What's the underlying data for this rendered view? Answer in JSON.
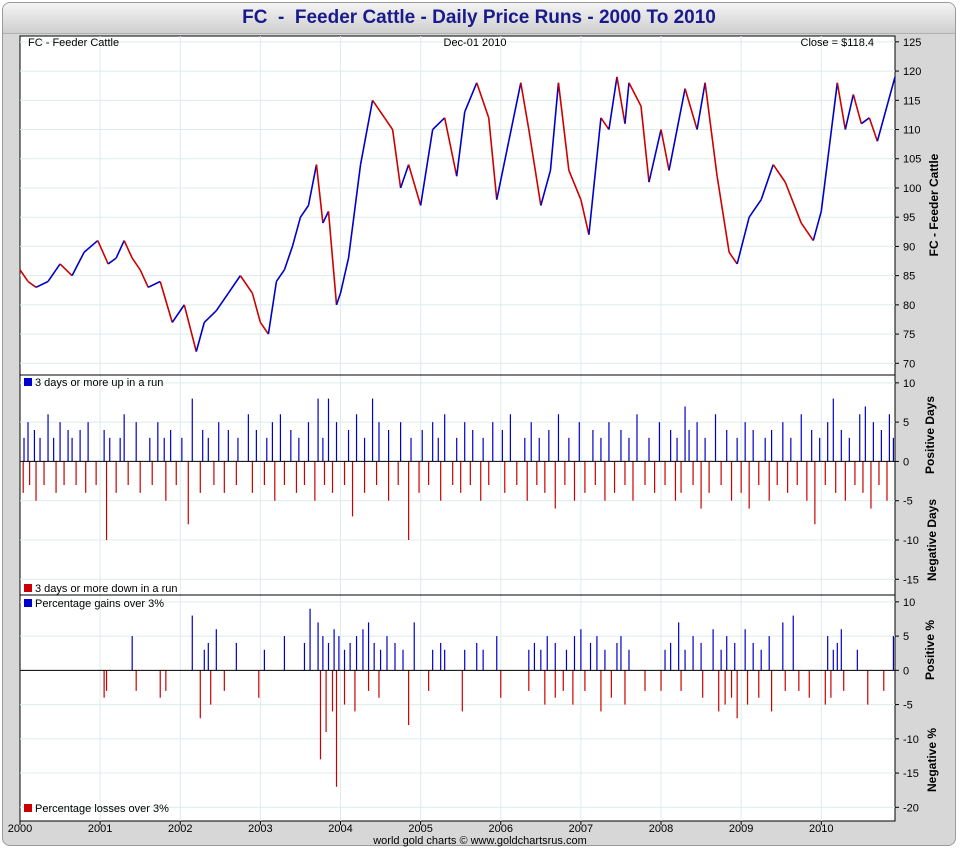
{
  "page": {
    "title": "FC  -  Feeder Cattle - Daily Price Runs - 2000 To 2010",
    "footer": "world gold charts © www.goldchartsrus.com"
  },
  "colors": {
    "up": "#0000cc",
    "down": "#cc0000",
    "price": "#000000",
    "grid": "#dcecec"
  },
  "chart_data": [
    {
      "type": "line",
      "panel": "price",
      "header_left": "FC  -  Feeder Cattle",
      "header_center": "Dec-01  2010",
      "header_right": "Close = $118.4",
      "ylabel": "FC  -  Feeder Cattle",
      "ylim": [
        68,
        126
      ],
      "yticks": [
        70,
        75,
        80,
        85,
        90,
        95,
        100,
        105,
        110,
        115,
        120,
        125
      ],
      "xlim": [
        2000.0,
        2010.92
      ],
      "series": [
        {
          "x": [
            2000.0,
            2000.1,
            2000.2,
            2000.35,
            2000.5,
            2000.65,
            2000.8,
            2000.97,
            2001.1,
            2001.2,
            2001.3,
            2001.4,
            2001.5,
            2001.6,
            2001.75,
            2001.9,
            2002.05,
            2002.2,
            2002.3,
            2002.45,
            2002.6,
            2002.75,
            2002.9,
            2003.0,
            2003.1,
            2003.2,
            2003.3,
            2003.4,
            2003.5,
            2003.6,
            2003.7,
            2003.78,
            2003.85,
            2003.95,
            2004.0,
            2004.1,
            2004.25,
            2004.4,
            2004.55,
            2004.65,
            2004.75,
            2004.85,
            2005.0,
            2005.15,
            2005.3,
            2005.45,
            2005.55,
            2005.7,
            2005.85,
            2005.95,
            2006.1,
            2006.25,
            2006.35,
            2006.5,
            2006.62,
            2006.72,
            2006.85,
            2007.0,
            2007.1,
            2007.25,
            2007.35,
            2007.45,
            2007.55,
            2007.6,
            2007.75,
            2007.85,
            2008.0,
            2008.1,
            2008.3,
            2008.45,
            2008.55,
            2008.7,
            2008.85,
            2008.95,
            2009.1,
            2009.25,
            2009.4,
            2009.55,
            2009.75,
            2009.9,
            2010.0,
            2010.1,
            2010.2,
            2010.3,
            2010.4,
            2010.5,
            2010.6,
            2010.7,
            2010.8,
            2010.92
          ],
          "y": [
            86,
            84,
            83,
            84,
            87,
            85,
            89,
            91,
            87,
            88,
            91,
            88,
            86,
            83,
            84,
            77,
            80,
            72,
            77,
            79,
            82,
            85,
            82,
            77,
            75,
            84,
            86,
            90,
            95,
            97,
            104,
            94,
            96,
            80,
            82,
            88,
            104,
            115,
            112,
            110,
            100,
            104,
            97,
            110,
            112,
            102,
            113,
            118,
            112,
            98,
            108,
            118,
            110,
            97,
            103,
            118,
            103,
            98,
            92,
            112,
            110,
            119,
            111,
            118,
            114,
            101,
            110,
            103,
            117,
            110,
            118,
            102,
            89,
            87,
            95,
            98,
            104,
            101,
            94,
            91,
            96,
            107,
            118,
            110,
            116,
            111,
            112,
            108,
            113,
            119
          ]
        }
      ]
    },
    {
      "type": "bar",
      "panel": "days",
      "legend_top": "3 days or more up in a run",
      "legend_bottom": "3 days or more down in a run",
      "ylabel_top": "Positive Days",
      "ylabel_bottom": "Negative Days",
      "ylim": [
        -17,
        11
      ],
      "yticks": [
        10,
        5,
        0,
        -5,
        -10,
        -15
      ],
      "series": [
        {
          "name": "3 days or more up in a run",
          "x": [
            2000.05,
            2000.1,
            2000.18,
            2000.25,
            2000.35,
            2000.42,
            2000.5,
            2000.6,
            2000.65,
            2000.75,
            2000.85,
            2001.05,
            2001.12,
            2001.25,
            2001.3,
            2001.45,
            2001.62,
            2001.72,
            2001.8,
            2001.88,
            2002.02,
            2002.15,
            2002.28,
            2002.35,
            2002.48,
            2002.6,
            2002.72,
            2002.85,
            2002.95,
            2003.08,
            2003.15,
            2003.25,
            2003.38,
            2003.48,
            2003.6,
            2003.72,
            2003.78,
            2003.85,
            2003.95,
            2004.1,
            2004.2,
            2004.3,
            2004.4,
            2004.48,
            2004.6,
            2004.75,
            2004.88,
            2005.02,
            2005.15,
            2005.22,
            2005.3,
            2005.45,
            2005.55,
            2005.65,
            2005.78,
            2005.9,
            2006.02,
            2006.12,
            2006.3,
            2006.38,
            2006.48,
            2006.6,
            2006.72,
            2006.85,
            2006.98,
            2007.15,
            2007.25,
            2007.35,
            2007.5,
            2007.6,
            2007.7,
            2007.85,
            2007.98,
            2008.12,
            2008.2,
            2008.3,
            2008.35,
            2008.45,
            2008.55,
            2008.68,
            2008.82,
            2008.95,
            2009.05,
            2009.15,
            2009.3,
            2009.38,
            2009.52,
            2009.62,
            2009.75,
            2009.88,
            2009.98,
            2010.08,
            2010.15,
            2010.25,
            2010.35,
            2010.48,
            2010.55,
            2010.65,
            2010.75,
            2010.85,
            2010.9
          ],
          "values": [
            3,
            5,
            4,
            3,
            6,
            3,
            5,
            4,
            3,
            4,
            5,
            4,
            3,
            3,
            6,
            5,
            3,
            5,
            3,
            4,
            3,
            8,
            4,
            3,
            5,
            4,
            3,
            6,
            4,
            3,
            5,
            6,
            4,
            3,
            5,
            8,
            3,
            8,
            5,
            4,
            6,
            3,
            8,
            5,
            4,
            5,
            3,
            4,
            5,
            3,
            6,
            3,
            5,
            4,
            3,
            5,
            4,
            6,
            3,
            5,
            3,
            4,
            6,
            3,
            5,
            4,
            3,
            5,
            4,
            3,
            6,
            3,
            5,
            4,
            3,
            7,
            4,
            5,
            3,
            6,
            4,
            3,
            5,
            4,
            3,
            4,
            5,
            3,
            6,
            4,
            3,
            5,
            8,
            4,
            3,
            6,
            7,
            5,
            4,
            6,
            3
          ]
        },
        {
          "name": "3 days or more down in a run",
          "x": [
            2000.04,
            2000.12,
            2000.2,
            2000.3,
            2000.45,
            2000.55,
            2000.7,
            2000.82,
            2000.95,
            2001.08,
            2001.2,
            2001.35,
            2001.5,
            2001.65,
            2001.82,
            2001.95,
            2002.1,
            2002.25,
            2002.42,
            2002.55,
            2002.7,
            2002.9,
            2003.05,
            2003.18,
            2003.3,
            2003.45,
            2003.55,
            2003.68,
            2003.8,
            2003.9,
            2004.05,
            2004.15,
            2004.3,
            2004.45,
            2004.6,
            2004.72,
            2004.85,
            2004.98,
            2005.1,
            2005.25,
            2005.4,
            2005.5,
            2005.62,
            2005.75,
            2005.85,
            2006.05,
            2006.2,
            2006.33,
            2006.45,
            2006.55,
            2006.68,
            2006.8,
            2006.92,
            2007.05,
            2007.18,
            2007.3,
            2007.42,
            2007.55,
            2007.65,
            2007.8,
            2007.92,
            2008.05,
            2008.18,
            2008.25,
            2008.4,
            2008.5,
            2008.6,
            2008.75,
            2008.88,
            2009.0,
            2009.1,
            2009.22,
            2009.35,
            2009.45,
            2009.58,
            2009.7,
            2009.82,
            2009.92,
            2010.05,
            2010.18,
            2010.3,
            2010.42,
            2010.52,
            2010.62,
            2010.72,
            2010.82
          ],
          "values": [
            -4,
            -3,
            -5,
            -3,
            -4,
            -3,
            -3,
            -4,
            -3,
            -10,
            -4,
            -3,
            -4,
            -3,
            -5,
            -3,
            -8,
            -4,
            -3,
            -4,
            -3,
            -4,
            -3,
            -5,
            -3,
            -4,
            -3,
            -5,
            -3,
            -4,
            -3,
            -7,
            -4,
            -3,
            -5,
            -3,
            -10,
            -4,
            -3,
            -5,
            -3,
            -4,
            -3,
            -5,
            -3,
            -4,
            -3,
            -5,
            -3,
            -4,
            -6,
            -3,
            -5,
            -4,
            -3,
            -5,
            -4,
            -3,
            -5,
            -3,
            -4,
            -3,
            -5,
            -4,
            -3,
            -6,
            -4,
            -3,
            -5,
            -4,
            -6,
            -3,
            -5,
            -3,
            -4,
            -3,
            -5,
            -8,
            -3,
            -4,
            -5,
            -3,
            -4,
            -6,
            -3,
            -5
          ]
        }
      ]
    },
    {
      "type": "bar",
      "panel": "percent",
      "legend_top": "Percentage gains over 3%",
      "legend_bottom": "Percentage losses over 3%",
      "ylabel_top": "Positive %",
      "ylabel_bottom": "Negative %",
      "ylim": [
        -22,
        11
      ],
      "yticks": [
        10,
        5,
        0,
        -5,
        -10,
        -15,
        -20
      ],
      "series": [
        {
          "name": "Percentage gains over 3%",
          "x": [
            2001.4,
            2002.15,
            2002.3,
            2002.35,
            2002.45,
            2002.7,
            2003.05,
            2003.3,
            2003.55,
            2003.62,
            2003.72,
            2003.78,
            2003.85,
            2003.92,
            2003.98,
            2004.05,
            2004.12,
            2004.2,
            2004.28,
            2004.35,
            2004.42,
            2004.5,
            2004.58,
            2004.68,
            2004.78,
            2004.92,
            2005.15,
            2005.25,
            2005.3,
            2005.55,
            2005.7,
            2005.78,
            2005.95,
            2006.35,
            2006.42,
            2006.5,
            2006.58,
            2006.68,
            2006.82,
            2006.92,
            2007.0,
            2007.12,
            2007.2,
            2007.3,
            2007.45,
            2007.5,
            2007.6,
            2008.05,
            2008.12,
            2008.22,
            2008.3,
            2008.4,
            2008.5,
            2008.65,
            2008.75,
            2008.82,
            2008.92,
            2009.05,
            2009.15,
            2009.25,
            2009.35,
            2009.52,
            2009.65,
            2010.08,
            2010.15,
            2010.2,
            2010.25,
            2010.45,
            2010.9
          ],
          "values": [
            5,
            8,
            3,
            4,
            6,
            4,
            3,
            5,
            4,
            9,
            7,
            5,
            4,
            6,
            5,
            3,
            4,
            5,
            6,
            7,
            4,
            3,
            5,
            4,
            3,
            7,
            3,
            4,
            3,
            3,
            4,
            3,
            5,
            3,
            4,
            3,
            5,
            4,
            3,
            5,
            6,
            4,
            5,
            3,
            4,
            5,
            3,
            3,
            4,
            7,
            3,
            5,
            4,
            6,
            3,
            5,
            4,
            6,
            4,
            3,
            5,
            7,
            8,
            5,
            3,
            4,
            6,
            3,
            5
          ]
        },
        {
          "name": "Percentage losses over 3%",
          "x": [
            2001.05,
            2001.08,
            2001.45,
            2001.75,
            2001.82,
            2002.25,
            2002.38,
            2002.55,
            2002.98,
            2003.75,
            2003.82,
            2003.9,
            2003.95,
            2004.05,
            2004.18,
            2004.35,
            2004.48,
            2004.85,
            2005.1,
            2005.52,
            2006.0,
            2006.35,
            2006.55,
            2006.68,
            2006.78,
            2006.9,
            2007.05,
            2007.25,
            2007.38,
            2007.55,
            2007.8,
            2008.0,
            2008.25,
            2008.52,
            2008.72,
            2008.8,
            2008.88,
            2008.95,
            2009.08,
            2009.22,
            2009.38,
            2009.55,
            2009.72,
            2009.85,
            2010.05,
            2010.12,
            2010.28,
            2010.58,
            2010.78
          ],
          "values": [
            -4,
            -3,
            -3,
            -4,
            -3,
            -7,
            -5,
            -3,
            -4,
            -13,
            -9,
            -6,
            -17,
            -5,
            -6,
            -3,
            -4,
            -8,
            -3,
            -6,
            -4,
            -3,
            -5,
            -4,
            -3,
            -5,
            -3,
            -6,
            -4,
            -5,
            -3,
            -3,
            -3,
            -4,
            -6,
            -5,
            -4,
            -7,
            -5,
            -4,
            -6,
            -3,
            -3,
            -4,
            -5,
            -4,
            -3,
            -5,
            -3
          ]
        }
      ]
    },
    {
      "type": "axis",
      "panel": "x-axis",
      "categories": [
        "2000",
        "2001",
        "2002",
        "2003",
        "2004",
        "2005",
        "2006",
        "2007",
        "2008",
        "2009",
        "2010"
      ]
    }
  ]
}
